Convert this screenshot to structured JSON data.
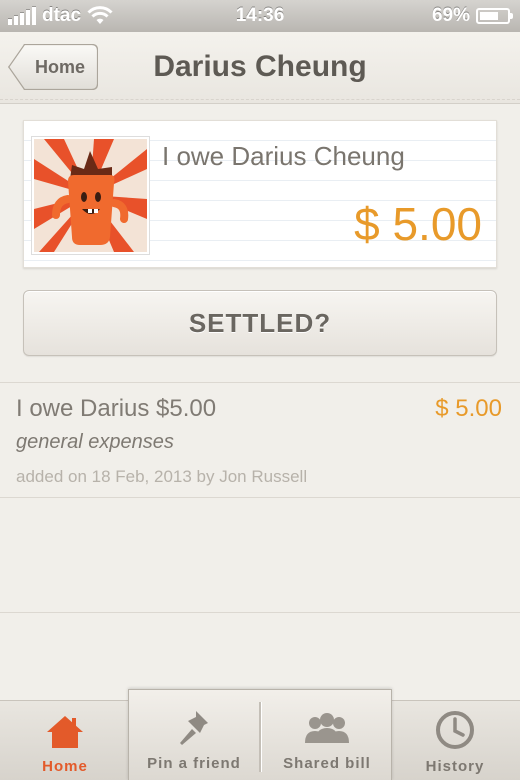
{
  "status_bar": {
    "carrier": "dtac",
    "time": "14:36",
    "battery_percent": "69%",
    "battery_level": 0.69
  },
  "nav": {
    "back_label": "Home",
    "title": "Darius Cheung"
  },
  "summary": {
    "title": "I owe Darius Cheung",
    "amount": "$ 5.00"
  },
  "settled_button": "SETTLED?",
  "expenses": [
    {
      "title": "I owe Darius $5.00",
      "amount": "$ 5.00",
      "category": "general expenses",
      "meta": "added on 18 Feb, 2013 by Jon Russell"
    }
  ],
  "tabs": [
    {
      "label": "Home",
      "icon": "house-icon",
      "active": true
    },
    {
      "label": "Pin a friend",
      "icon": "pushpin-icon",
      "active": false
    },
    {
      "label": "Shared bill",
      "icon": "group-icon",
      "active": false
    },
    {
      "label": "History",
      "icon": "clock-icon",
      "active": false
    }
  ],
  "colors": {
    "accent_amount": "#e89a2a",
    "active_tab": "#e35a2a",
    "background": "#f1efea"
  }
}
